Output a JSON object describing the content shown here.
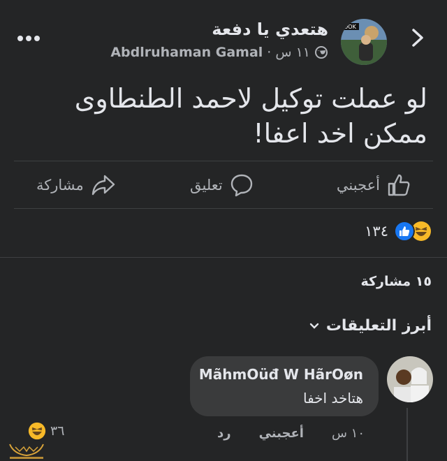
{
  "post": {
    "group_name": "هتعدي يا دفعة",
    "author": "Abdlruhaman Gamal",
    "time": "١١ س",
    "separator": "·",
    "text": "لو عملت توكيل لاحمد الطنطاوى ممكن اخد اعفا!"
  },
  "actions": {
    "like": "أعجبني",
    "comment": "تعليق",
    "share": "مشاركة"
  },
  "reactions": {
    "count": "١٣٤",
    "types": [
      "haha",
      "like"
    ]
  },
  "shares": {
    "label": "١٥ مشاركة"
  },
  "comments": {
    "section_label": "أبرز التعليقات",
    "top": {
      "author": "MãhmOüđ W HãrOøn",
      "text": "هتاخد اخفا",
      "time": "١٠ س",
      "like_label": "أعجبني",
      "reply_label": "رد",
      "reaction_count": "٣٦"
    }
  },
  "icons": {
    "back": "chevron-right-icon",
    "more": "more-dots-icon",
    "audience": "globe-icon",
    "like": "thumbs-up-icon",
    "comment": "speech-bubble-icon",
    "share": "share-arrow-icon",
    "dropdown": "chevron-down-icon"
  },
  "colors": {
    "background": "#242526",
    "text": "#e4e6eb",
    "muted": "#b0b3b8",
    "bubble": "#3a3b3c",
    "like_blue": "#1877f2",
    "haha_yellow": "#f7b928"
  }
}
